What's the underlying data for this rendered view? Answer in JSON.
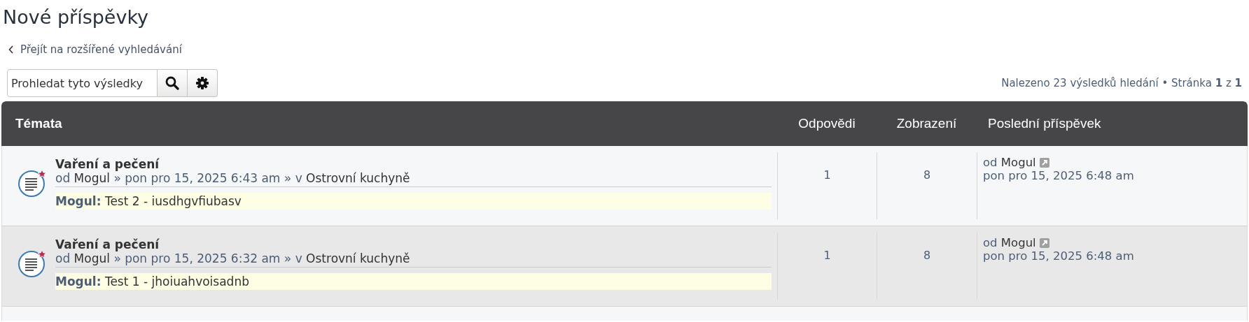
{
  "page_title": "Nové příspěvky",
  "back_link": "Přejít na rozšířené vyhledávání",
  "search": {
    "placeholder": "Prohledat tyto výsledky"
  },
  "pagination": "Nalezeno 23 výsledků hledání • Stránka **1** z **1**",
  "table": {
    "columns": [
      "Témata",
      "Odpovědi",
      "Zobrazení",
      "Poslední příspěvek"
    ],
    "rows": [
      {
        "title": "Vaření a pečení",
        "meta_prefix": "od",
        "author": "Mogul",
        "meta_middle": "» pon pro 15, 2025 6:43 am » v",
        "forum": "Ostrovní kuchyně",
        "preview": "**Mogul:** Test 2 - iusdhgvfiubasv",
        "unread": true,
        "replies": "1",
        "views": "8",
        "last_prefix": "od",
        "last_author": "Mogul",
        "last_time": "pon pro 15, 2025 6:48 am"
      },
      {
        "title": "Vaření a pečení",
        "meta_prefix": "od",
        "author": "Mogul",
        "meta_middle": "» pon pro 15, 2025 6:32 am » v",
        "forum": "Ostrovní kuchyně",
        "preview": "**Mogul:** Test 1 - jhoiuahvoisadnb",
        "unread": true,
        "replies": "1",
        "views": "8",
        "last_prefix": "od",
        "last_author": "Mogul",
        "last_time": "pon pro 15, 2025 6:48 am"
      }
    ]
  }
}
